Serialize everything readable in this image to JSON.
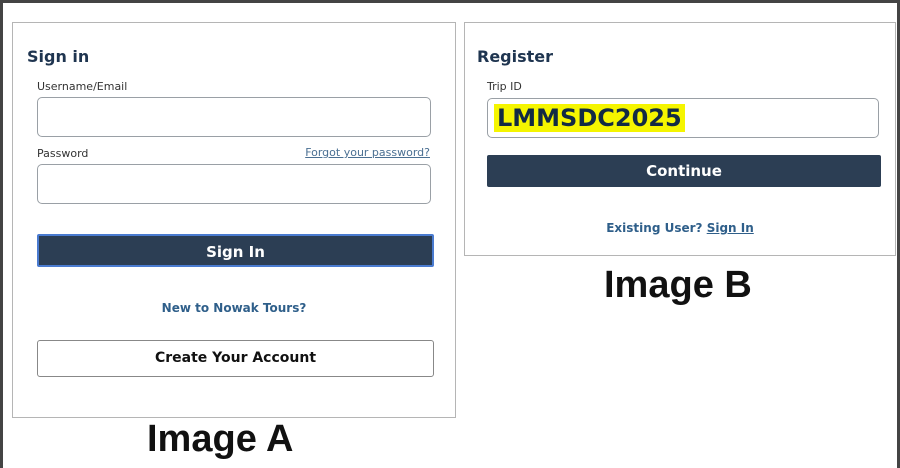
{
  "image_a": {
    "title": "Sign in",
    "username_label": "Username/Email",
    "username_value": "",
    "password_label": "Password",
    "password_value": "",
    "forgot_link": "Forgot your password?",
    "signin_button": "Sign In",
    "new_user_text": "New to Nowak Tours?",
    "create_account_button": "Create Your Account",
    "caption": "Image A"
  },
  "image_b": {
    "title": "Register",
    "trip_id_label": "Trip ID",
    "trip_id_value": "LMMSDC2025",
    "continue_button": "Continue",
    "existing_user_text": "Existing User?",
    "signin_link": "Sign In",
    "caption": "Image B"
  },
  "colors": {
    "primary_button": "#2c3e54",
    "title_text": "#1f3550",
    "link": "#2f5f8a",
    "highlight": "#f5f500"
  }
}
